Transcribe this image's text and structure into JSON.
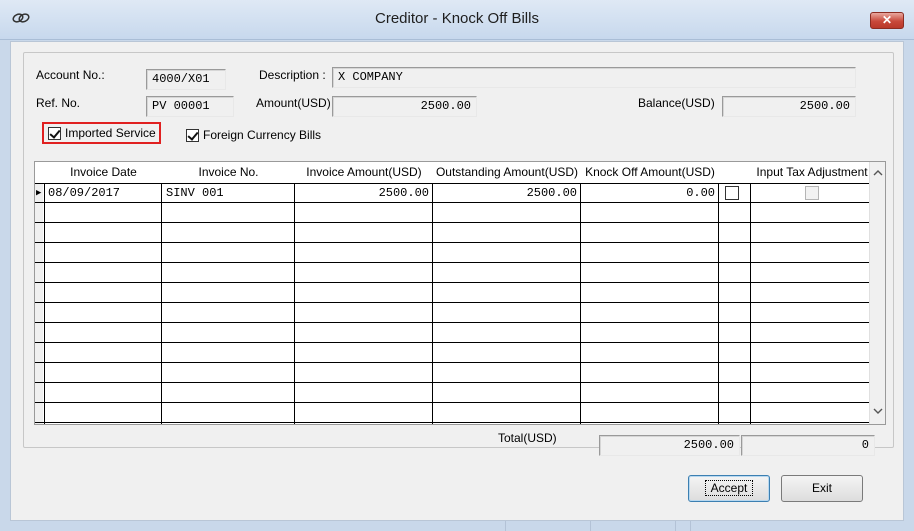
{
  "window": {
    "title": "Creditor - Knock Off Bills",
    "close_glyph": "✕"
  },
  "form": {
    "account_no_label": "Account No.:",
    "account_no": "4000/X01",
    "description_label": "Description :",
    "description": "X COMPANY",
    "ref_no_label": "Ref. No.",
    "ref_no": "PV 00001",
    "amount_label": "Amount(USD)",
    "amount": "2500.00",
    "balance_label": "Balance(USD)",
    "balance": "2500.00",
    "imported_service_label": "Imported Service",
    "imported_service_checked": true,
    "foreign_currency_label": "Foreign Currency Bills",
    "foreign_currency_checked": true
  },
  "grid": {
    "columns": [
      "Invoice Date",
      "Invoice No.",
      "Invoice Amount(USD)",
      "Outstanding Amount(USD)",
      "Knock Off Amount(USD)",
      "",
      "Input Tax Adjustment"
    ],
    "rows": [
      {
        "invoice_date": "08/09/2017",
        "invoice_no": "SINV 001",
        "invoice_amount": "2500.00",
        "outstanding_amount": "2500.00",
        "knock_off_amount": "0.00",
        "knock_off_checked": false,
        "input_tax_adjustment_checked": false
      }
    ],
    "row_indicator": "▶"
  },
  "totals": {
    "label": "Total(USD)",
    "total": "2500.00",
    "knock_off_total": "0"
  },
  "buttons": {
    "accept": "Accept",
    "exit": "Exit"
  }
}
